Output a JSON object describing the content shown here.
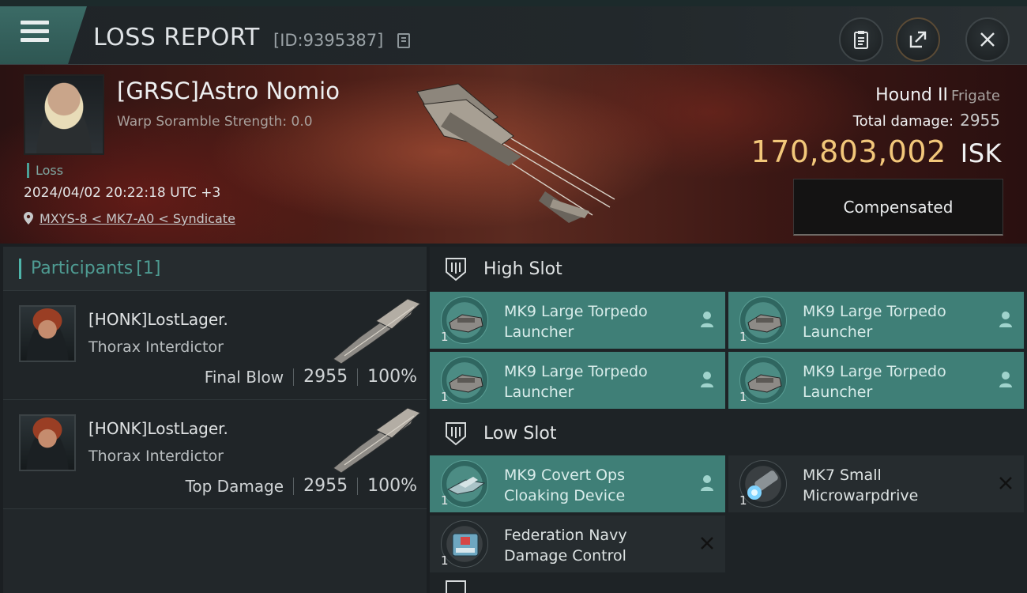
{
  "header": {
    "title": "LOSS REPORT",
    "report_id": "[ID:9395387]"
  },
  "victim": {
    "name": "[GRSC]Astro Nomio",
    "scramble": "Warp Soramble Strength: 0.0",
    "status": "Loss",
    "datetime": "2024/04/02 20:22:18 UTC +3",
    "location": "MXYS-8 < MK7-A0 < Syndicate"
  },
  "ship": {
    "name": "Hound II",
    "class": "Frigate",
    "total_damage_label": "Total damage:",
    "total_damage": "2955",
    "value": "170,803,002",
    "currency": "ISK",
    "compensation": "Compensated"
  },
  "participants": {
    "label": "Participants",
    "count": "[1]",
    "rows": [
      {
        "name": "[HONK]LostLager.",
        "ship": "Thorax Interdictor",
        "tag": "Final Blow",
        "damage": "2955",
        "percent": "100%"
      },
      {
        "name": "[HONK]LostLager.",
        "ship": "Thorax Interdictor",
        "tag": "Top Damage",
        "damage": "2955",
        "percent": "100%"
      }
    ]
  },
  "slots": {
    "high": {
      "label": "High Slot",
      "modules": [
        {
          "name": "MK9 Large Torpedo Launcher",
          "qty": "1",
          "state": "owner"
        },
        {
          "name": "MK9 Large Torpedo Launcher",
          "qty": "1",
          "state": "owner"
        },
        {
          "name": "MK9 Large Torpedo Launcher",
          "qty": "1",
          "state": "owner"
        },
        {
          "name": "MK9 Large Torpedo Launcher",
          "qty": "1",
          "state": "owner"
        }
      ]
    },
    "low": {
      "label": "Low Slot",
      "modules": [
        {
          "name": "MK9 Covert Ops Cloaking Device",
          "qty": "1",
          "state": "owner"
        },
        {
          "name": "MK7 Small Microwarpdrive",
          "qty": "1",
          "state": "destroyed"
        },
        {
          "name": "Federation Navy Damage Control",
          "qty": "1",
          "state": "destroyed"
        }
      ]
    }
  },
  "colors": {
    "accent": "#4fb5aa",
    "isk_gold": "#f2c77a",
    "module_active": "#3f7f77"
  }
}
